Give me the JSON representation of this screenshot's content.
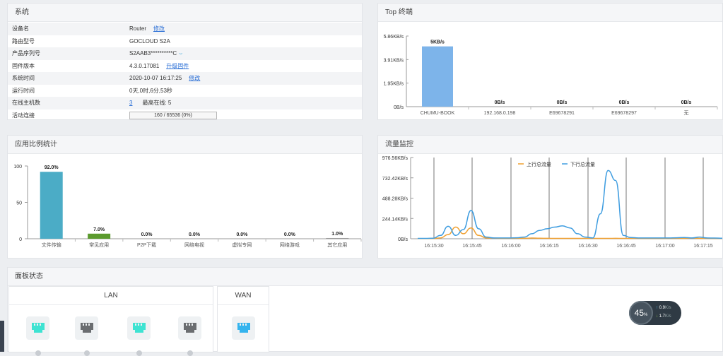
{
  "system": {
    "title": "系统",
    "rows": [
      {
        "label": "设备名",
        "value": "Router",
        "link": "修改"
      },
      {
        "label": "路由型号",
        "value": "GOCLOUD S2A"
      },
      {
        "label": "产品序列号",
        "value": "S2AAB3**********C",
        "icon": "eye-icon"
      },
      {
        "label": "固件版本",
        "value": "4.3.0.17081",
        "link": "升级固件"
      },
      {
        "label": "系统时间",
        "value": "2020-10-07 16:17:25",
        "link": "修改"
      },
      {
        "label": "运行时间",
        "value": "0天,0时,6分,53秒"
      },
      {
        "label": "在线主机数",
        "value": "3",
        "extra_label": "最高在线:",
        "extra_value": "5"
      },
      {
        "label": "活动连接",
        "value": "160 / 65536 (0%)",
        "progress": 0
      }
    ]
  },
  "top": {
    "title": "Top 终端"
  },
  "app": {
    "title": "应用比例统计"
  },
  "flow": {
    "title": "流量监控"
  },
  "board": {
    "title": "面板状态",
    "lan": "LAN",
    "wan": "WAN"
  },
  "speed": {
    "percent": "45",
    "unit": "%",
    "up": "0.9",
    "up_unit": "K/s",
    "down": "1.7",
    "down_unit": "K/s"
  },
  "chart_data": [
    {
      "type": "bar",
      "title": "Top 终端",
      "categories": [
        "CHUMU-BOOK",
        "192.168.0.198",
        "E69678291",
        "E69678297",
        "无"
      ],
      "values": [
        5,
        0,
        0,
        0,
        0
      ],
      "data_labels": [
        "5KB/s",
        "0B/s",
        "0B/s",
        "0B/s",
        "0B/s"
      ],
      "yticks": [
        "0B/s",
        "1.95KB/s",
        "3.91KB/s",
        "5.86KB/s"
      ],
      "ylim": [
        0,
        5.86
      ],
      "color": "#7db4ea"
    },
    {
      "type": "bar",
      "title": "应用比例统计",
      "categories": [
        "文件传输",
        "常见应用",
        "P2P下载",
        "网络电视",
        "虚拟专网",
        "网络游戏",
        "其它应用"
      ],
      "values": [
        92.0,
        7.0,
        0.0,
        0.0,
        0.0,
        0.0,
        1.0
      ],
      "data_labels": [
        "92.0%",
        "7.0%",
        "0.0%",
        "0.0%",
        "0.0%",
        "0.0%",
        "1.0%"
      ],
      "colors": [
        "#4bacc6",
        "#5b9a2e",
        "#999999",
        "#999999",
        "#999999",
        "#999999",
        "#999999"
      ],
      "yticks": [
        "0",
        "50",
        "100"
      ],
      "ylim": [
        0,
        100
      ]
    },
    {
      "type": "line",
      "title": "流量监控",
      "yticks": [
        "0B/s",
        "244.14KB/s",
        "488.28KB/s",
        "732.42KB/s",
        "976.56KB/s"
      ],
      "ylim": [
        0,
        976.56
      ],
      "xticks": [
        "16:15:30",
        "16:15:45",
        "16:16:00",
        "16:16:15",
        "16:16:30",
        "16:16:45",
        "16:17:00",
        "16:17:15"
      ],
      "legend_position": "top",
      "series": [
        {
          "name": "上行总流量",
          "color": "#f0a030",
          "values": [
            2,
            2,
            3,
            10,
            50,
            140,
            60,
            130,
            40,
            10,
            8,
            5,
            5,
            5,
            5,
            8,
            6,
            5,
            4,
            4,
            4,
            4,
            4,
            4,
            4,
            4,
            5,
            4,
            4,
            4,
            4,
            4,
            4,
            4,
            4,
            4,
            8,
            4,
            4,
            4,
            4
          ]
        },
        {
          "name": "下行总流量",
          "color": "#3f9de0",
          "values": [
            4,
            4,
            6,
            40,
            150,
            40,
            110,
            340,
            120,
            20,
            10,
            10,
            10,
            12,
            20,
            60,
            100,
            120,
            140,
            155,
            130,
            60,
            20,
            10,
            300,
            820,
            700,
            40,
            15,
            10,
            10,
            10,
            10,
            10,
            12,
            15,
            10,
            20,
            10,
            8,
            6
          ]
        }
      ]
    }
  ]
}
